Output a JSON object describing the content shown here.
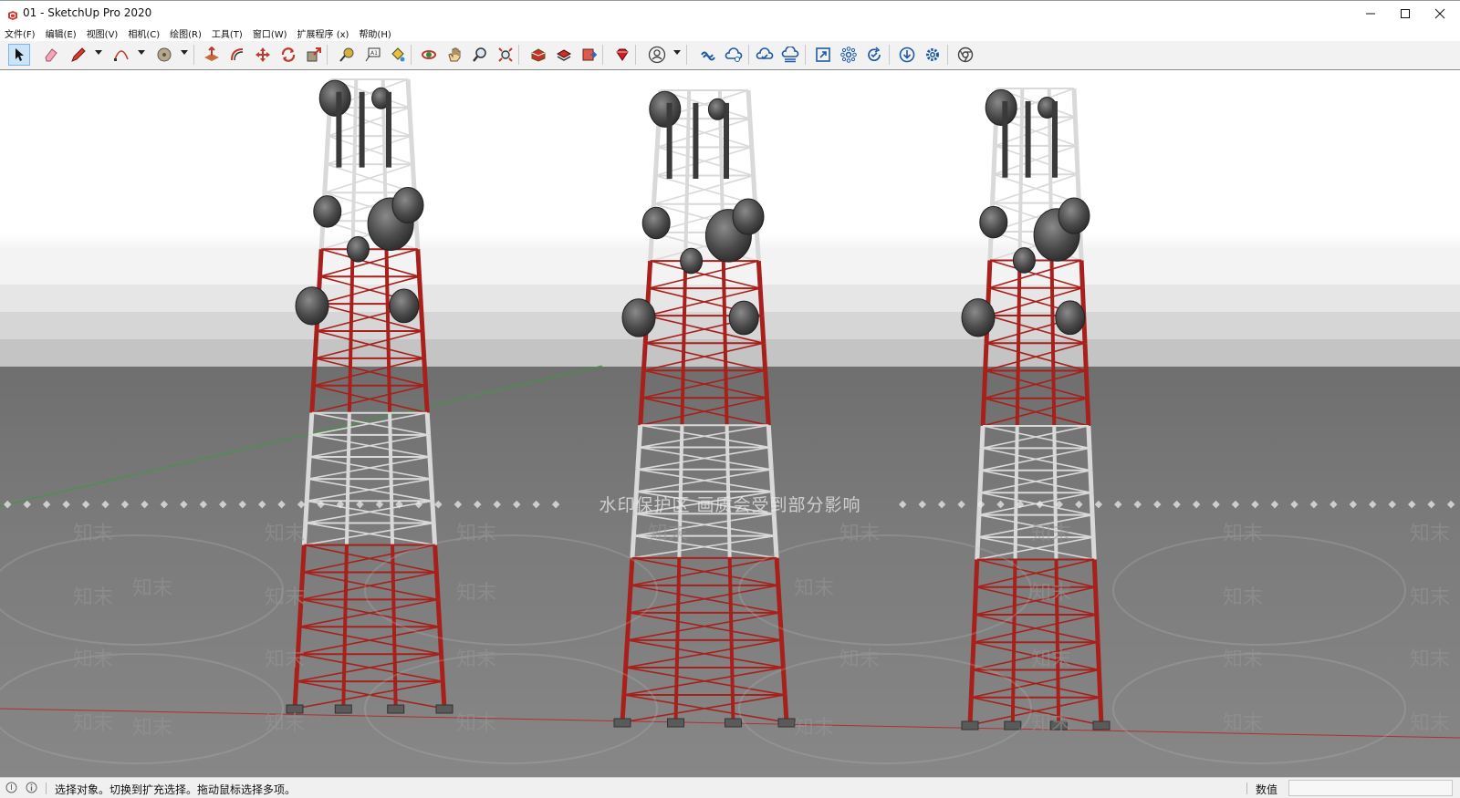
{
  "window": {
    "title": "01 - SketchUp Pro 2020",
    "controls": [
      "minimize-icon",
      "maximize-icon",
      "close-icon"
    ]
  },
  "menu": [
    "文件(F)",
    "编辑(E)",
    "视图(V)",
    "相机(C)",
    "绘图(R)",
    "工具(T)",
    "窗口(W)",
    "扩展程序 (x)",
    "帮助(H)"
  ],
  "toolbar": {
    "tools": [
      {
        "name": "select-icon",
        "active": true
      },
      {
        "name": "eraser-icon"
      },
      {
        "name": "pencil-line-icon",
        "dropdown": true
      },
      {
        "name": "arc-icon",
        "dropdown": true
      },
      {
        "name": "shape-icon",
        "dropdown": true
      },
      {
        "name": "push-pull-icon"
      },
      {
        "name": "offset-icon"
      },
      {
        "name": "move-icon"
      },
      {
        "name": "rotate-icon"
      },
      {
        "name": "scale-icon"
      },
      {
        "name": "tape-measure-icon"
      },
      {
        "name": "text-icon"
      },
      {
        "name": "paint-bucket-icon"
      },
      {
        "name": "orbit-icon"
      },
      {
        "name": "pan-icon"
      },
      {
        "name": "zoom-icon"
      },
      {
        "name": "zoom-extents-icon"
      },
      {
        "name": "3d-warehouse-icon"
      },
      {
        "name": "extension-warehouse-icon"
      },
      {
        "name": "layout-icon"
      },
      {
        "name": "ruby-console-icon"
      },
      {
        "name": "user-account-icon",
        "dropdown": true
      },
      {
        "name": "trimble-connect-icon"
      },
      {
        "name": "cloud-share-icon"
      },
      {
        "name": "cloud-sync-icon"
      },
      {
        "name": "cloud-collaborate-icon"
      },
      {
        "name": "fullscreen-icon"
      },
      {
        "name": "network-icon"
      },
      {
        "name": "refresh-check-icon"
      },
      {
        "name": "download-icon"
      },
      {
        "name": "settings-icon"
      },
      {
        "name": "chrome-icon"
      }
    ]
  },
  "viewport": {
    "watermark_banner": "水印保护区  画质会受到部分影响",
    "watermark_word": "知末",
    "colors": {
      "sky_top": "#ffffff",
      "sky_bottom": "#d9d9d9",
      "ground": "#7a7a7a",
      "tower_red": "#a8201c",
      "tower_white": "#d9d9d9",
      "axis_green": "#3c9a3c",
      "axis_red": "#b03030"
    }
  },
  "status": {
    "message": "选择对象。切换到扩充选择。拖动鼠标选择多项。",
    "vcb_label": "数值",
    "vcb_value": ""
  }
}
